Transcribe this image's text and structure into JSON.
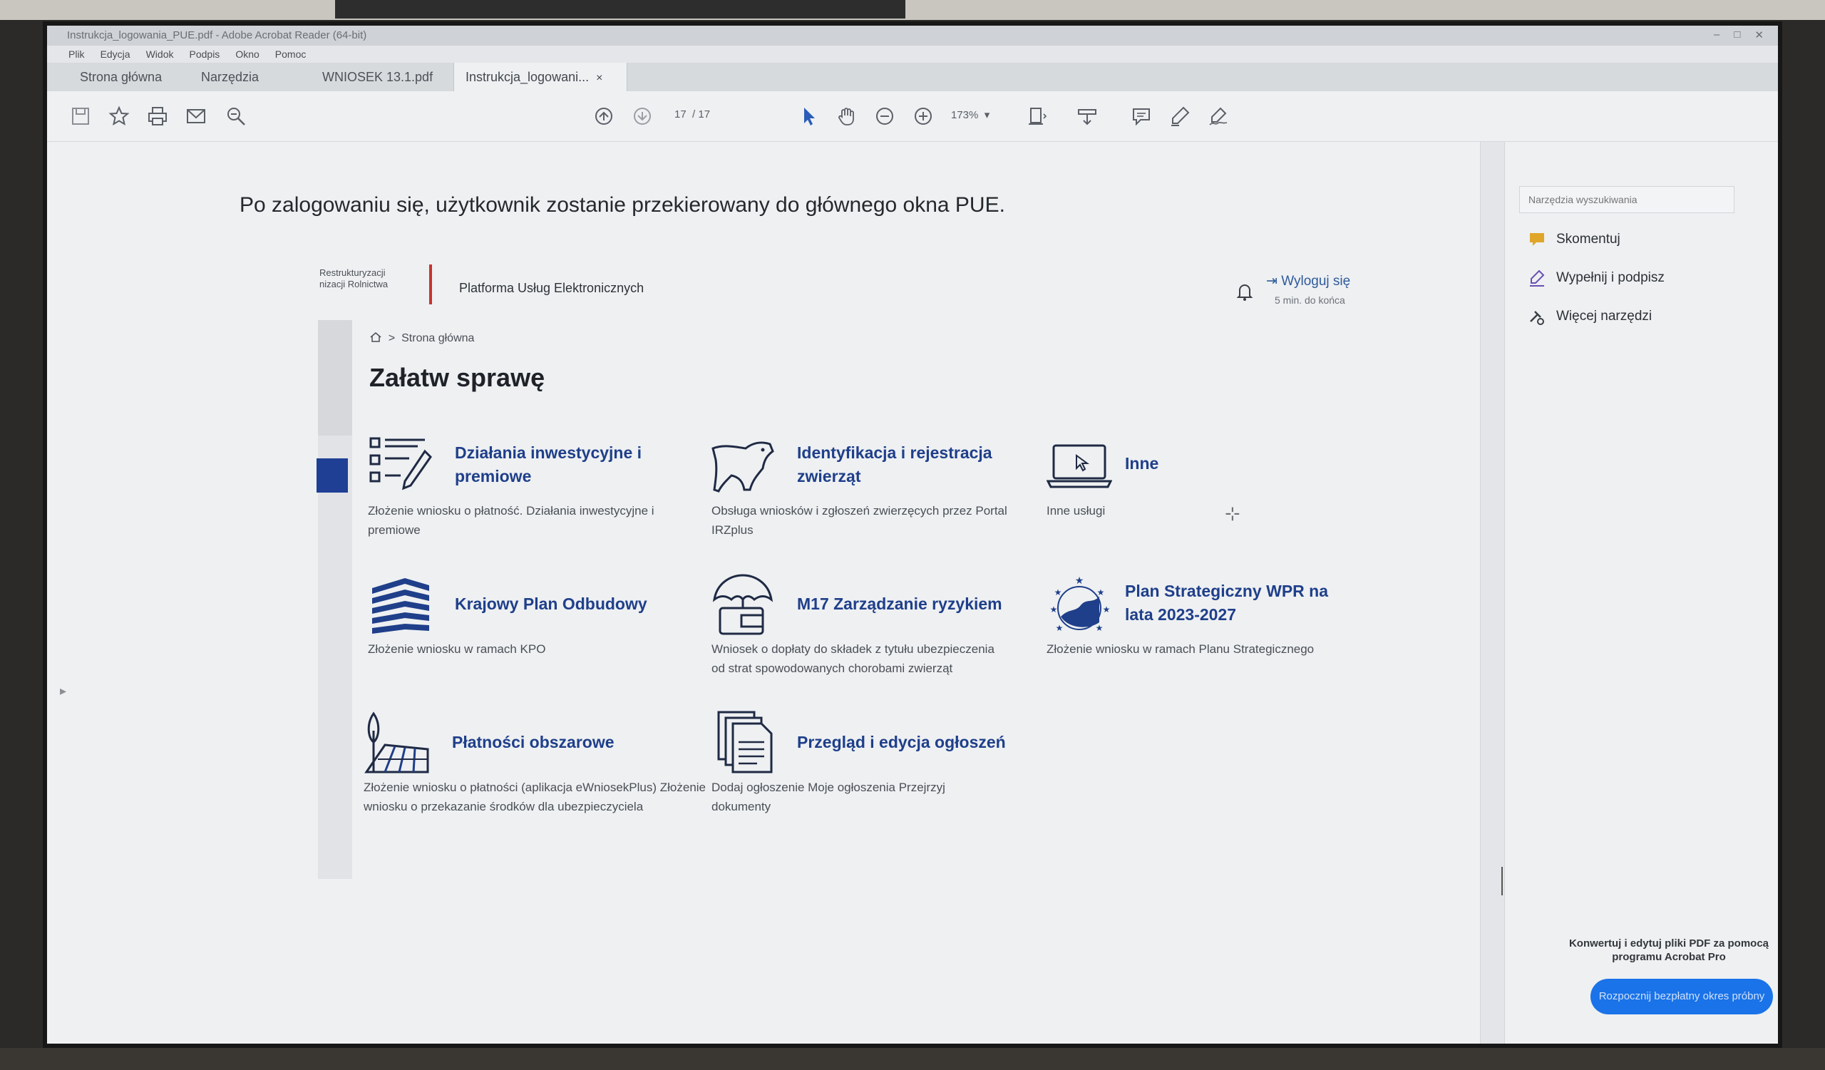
{
  "window": {
    "title": "Instrukcja_logowania_PUE.pdf - Adobe Acrobat Reader (64-bit)",
    "controls": [
      "–",
      "□",
      "✕"
    ]
  },
  "menu": [
    "Plik",
    "Edycja",
    "Widok",
    "Podpis",
    "Okno",
    "Pomoc"
  ],
  "tabs": {
    "home": "Strona główna",
    "tools": "Narzędzia",
    "doc1": "WNIOSEK 13.1.pdf",
    "doc2": "Instrukcja_logowani...",
    "close": "×"
  },
  "toolbar": {
    "page_current": "17",
    "page_total": "/ 17",
    "zoom": "173%"
  },
  "document": {
    "intro": "Po zalogowaniu się, użytkownik zostanie przekierowany do głównego okna PUE.",
    "logo_line1": "Restrukturyzacji",
    "logo_line2": "nizacji Rolnictwa",
    "platform": "Platforma Usług Elektronicznych",
    "logout": "Wyloguj się",
    "logout_sub": "5 min. do końca",
    "breadcrumb": "Strona główna",
    "heading": "Załatw sprawę",
    "tiles": [
      {
        "title": "Działania inwestycyjne i premiowe",
        "desc": "Złożenie wniosku o płatność. Działania inwestycyjne i premiowe",
        "icon": "checklist-icon"
      },
      {
        "title": "Identyfikacja i rejestracja zwierząt",
        "desc": "Obsługa wniosków i zgłoszeń zwierzęcych przez Portal IRZplus",
        "icon": "cow-icon"
      },
      {
        "title": "Inne",
        "desc": "Inne usługi",
        "icon": "laptop-icon"
      },
      {
        "title": "Krajowy Plan Odbudowy",
        "desc": "Złożenie wniosku w ramach KPO",
        "icon": "kpo-icon"
      },
      {
        "title": "M17 Zarządzanie ryzykiem",
        "desc": "Wniosek o dopłaty do składek z tytułu ubezpieczenia od strat spowodowanych chorobami zwierząt",
        "icon": "umbrella-wallet-icon"
      },
      {
        "title": "Plan Strategiczny WPR na lata 2023-2027",
        "desc": "Złożenie wniosku w ramach Planu Strategicznego",
        "icon": "eu-stars-icon"
      },
      {
        "title": "Płatności obszarowe",
        "desc": "Złożenie wniosku o płatności (aplikacja eWniosekPlus) Złożenie wniosku o przekazanie środków dla ubezpieczyciela",
        "icon": "field-tree-icon"
      },
      {
        "title": "Przegląd i edycja ogłoszeń",
        "desc": "Dodaj ogłoszenie Moje ogłoszenia Przejrzyj dokumenty",
        "icon": "documents-icon"
      }
    ]
  },
  "right_panel": {
    "search_placeholder": "Narzędzia wyszukiwania",
    "tools": [
      "Skomentuj",
      "Wypełnij i podpisz",
      "Więcej narzędzi"
    ],
    "promo": "Konwertuj i edytuj pliki PDF za pomocą programu Acrobat Pro",
    "trial_button": "Rozpocznij bezpłatny okres próbny"
  },
  "colors": {
    "brand_blue": "#1f3f8a",
    "accent_red": "#c9332e",
    "button_blue": "#1a73e8"
  }
}
